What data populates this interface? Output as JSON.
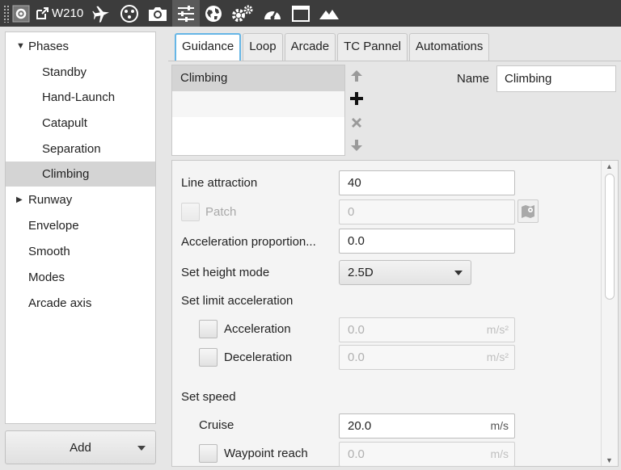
{
  "toolbar": {
    "vehicle_label": "W210",
    "icons": [
      "settings-icon",
      "external-link-icon",
      "plane-icon",
      "sensors-icon",
      "camera-icon",
      "sliders-icon",
      "globe-icon",
      "gears-icon",
      "gauge-icon",
      "window-icon",
      "terrain-icon"
    ]
  },
  "tree": {
    "items": [
      {
        "label": "Phases",
        "expanded": true
      },
      {
        "label": "Standby"
      },
      {
        "label": "Hand-Launch"
      },
      {
        "label": "Catapult"
      },
      {
        "label": "Separation"
      },
      {
        "label": "Climbing",
        "selected": true
      },
      {
        "label": "Runway",
        "expanded": false
      },
      {
        "label": "Envelope"
      },
      {
        "label": "Smooth"
      },
      {
        "label": "Modes"
      },
      {
        "label": "Arcade axis"
      }
    ],
    "add_label": "Add"
  },
  "tabs": [
    "Guidance",
    "Loop",
    "Arcade",
    "TC Pannel",
    "Automations"
  ],
  "active_tab": "Guidance",
  "phase_list": {
    "rows": [
      "Climbing",
      "",
      "",
      ""
    ]
  },
  "name": {
    "label": "Name",
    "value": "Climbing"
  },
  "form": {
    "line_attraction": {
      "label": "Line attraction",
      "value": "40"
    },
    "patch": {
      "label": "Patch",
      "value": "0"
    },
    "accel_proportion": {
      "label": "Acceleration proportion...",
      "value": "0.0"
    },
    "height_mode": {
      "label": "Set height mode",
      "value": "2.5D"
    },
    "limit_accel": {
      "label": "Set limit acceleration"
    },
    "acceleration": {
      "label": "Acceleration",
      "value": "0.0",
      "unit": "m/s²"
    },
    "deceleration": {
      "label": "Deceleration",
      "value": "0.0",
      "unit": "m/s²"
    },
    "set_speed": {
      "label": "Set speed"
    },
    "cruise": {
      "label": "Cruise",
      "value": "20.0",
      "unit": "m/s"
    },
    "waypoint_reach": {
      "label": "Waypoint reach",
      "value": "0.0",
      "unit": "m/s"
    }
  },
  "colors": {
    "toolbar_bg": "#3c3c3c",
    "selection": "#d4d4d4",
    "tab_focus": "#66b6e6"
  }
}
